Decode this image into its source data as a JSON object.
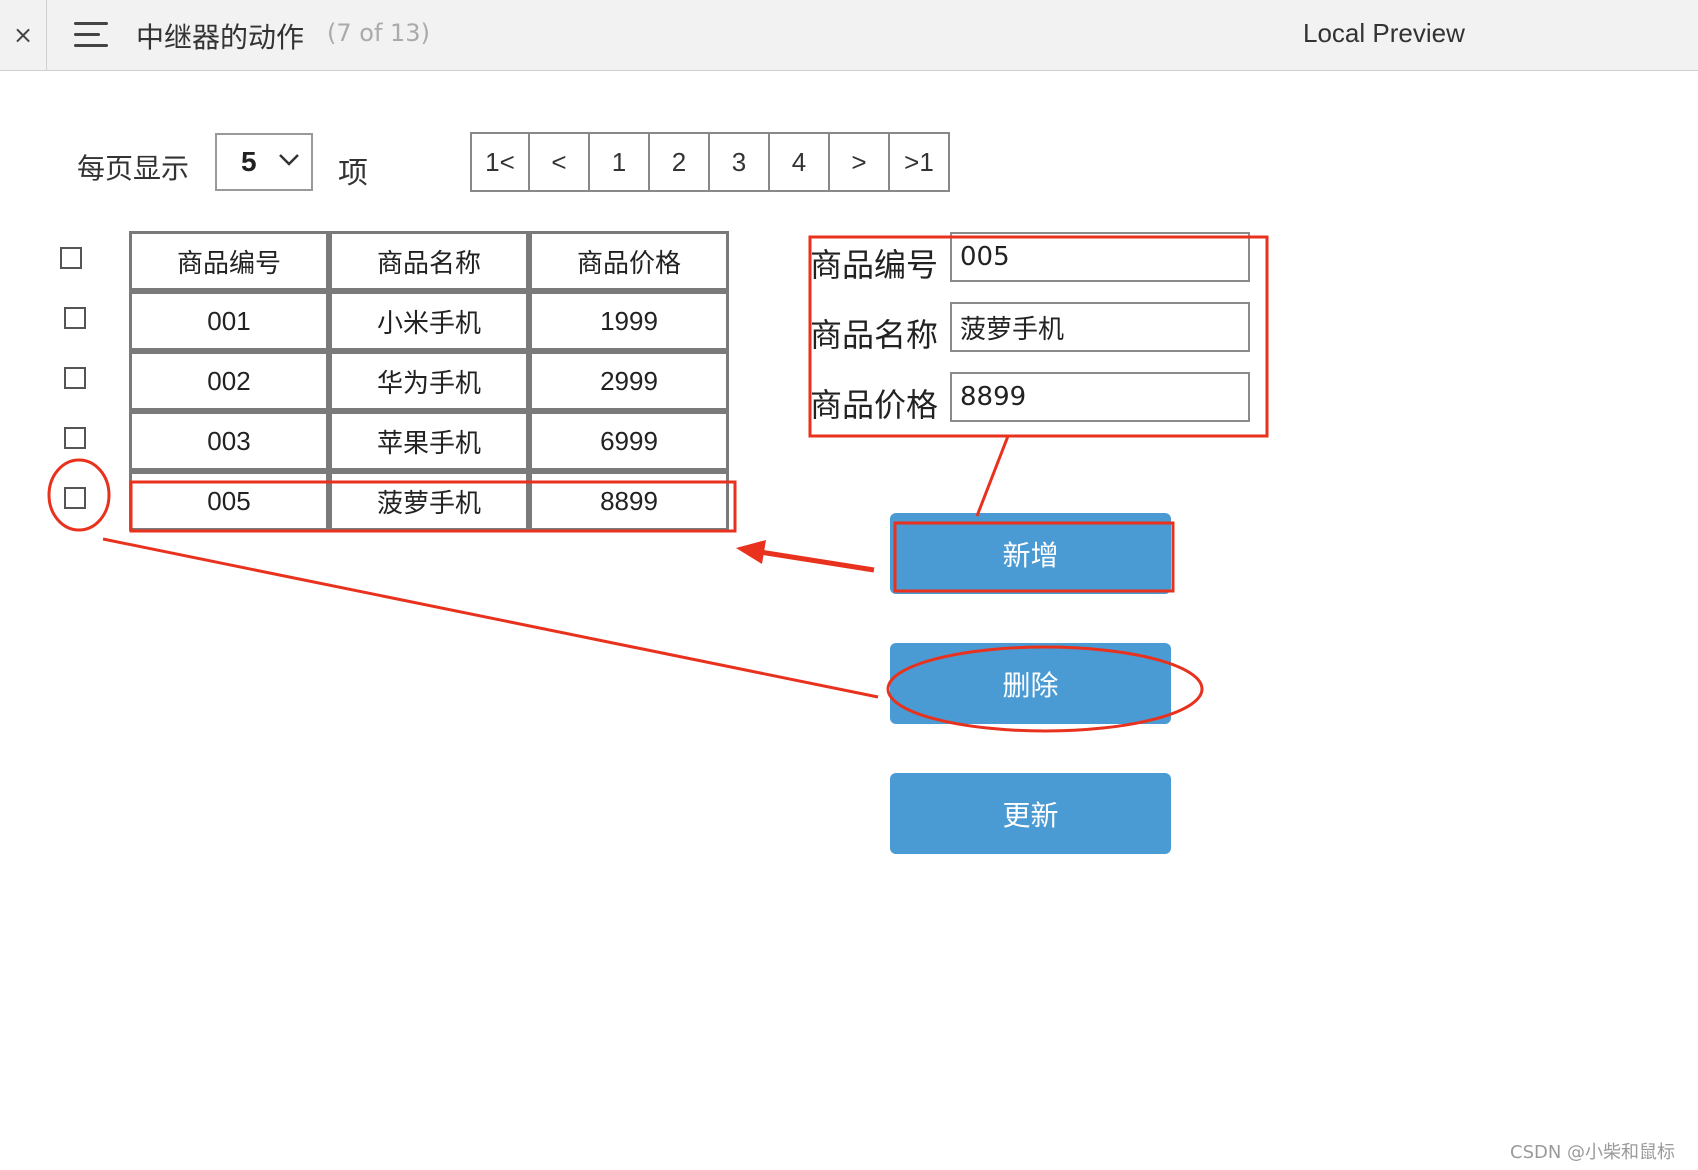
{
  "topbar": {
    "close_glyph": "×",
    "menu_icon": "hamburger-menu-icon",
    "title": "中继器的动作",
    "page_count": "(7 of 13)",
    "preview_label": "Local Preview"
  },
  "controls": {
    "per_page_label": "每页显示",
    "per_page_value": "5",
    "items_unit": "项",
    "pager": [
      "1<",
      "<",
      "1",
      "2",
      "3",
      "4",
      ">",
      ">1"
    ]
  },
  "table": {
    "headers": [
      "商品编号",
      "商品名称",
      "商品价格"
    ],
    "rows": [
      [
        "001",
        "小米手机",
        "1999"
      ],
      [
        "002",
        "华为手机",
        "2999"
      ],
      [
        "003",
        "苹果手机",
        "6999"
      ],
      [
        "005",
        "菠萝手机",
        "8899"
      ]
    ]
  },
  "form": {
    "id_label": "商品编号",
    "id_value": "005",
    "name_label": "商品名称",
    "name_value": "菠萝手机",
    "price_label": "商品价格",
    "price_value": "8899"
  },
  "buttons": {
    "add": "新增",
    "delete": "删除",
    "update": "更新"
  },
  "annotation_color": "#e8321e",
  "button_color": "#4a9ad4",
  "watermark": "CSDN @小柴和鼠标"
}
